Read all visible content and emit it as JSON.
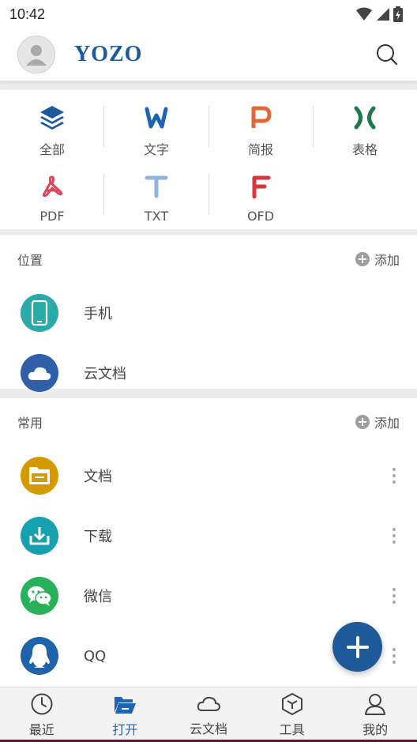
{
  "status": {
    "time": "10:42"
  },
  "header": {
    "logo": "YOZO"
  },
  "types": [
    {
      "label": "全部",
      "icon": "layers-icon",
      "color": "#1e5a99"
    },
    {
      "label": "文字",
      "icon": "word-icon",
      "color": "#1e64b4"
    },
    {
      "label": "简报",
      "icon": "presentation-icon",
      "color": "#e2673a"
    },
    {
      "label": "表格",
      "icon": "spreadsheet-icon",
      "color": "#1d7a4a"
    },
    {
      "label": "PDF",
      "icon": "pdf-icon",
      "color": "#e0445a"
    },
    {
      "label": "TXT",
      "icon": "txt-icon",
      "color": "#8db4e2"
    },
    {
      "label": "OFD",
      "icon": "ofd-icon",
      "color": "#d9363e"
    }
  ],
  "location": {
    "title": "位置",
    "add_label": "添加",
    "items": [
      {
        "name": "手机",
        "icon": "phone-icon",
        "color": "#2aaaa8"
      },
      {
        "name": "云文档",
        "icon": "cloud-icon",
        "color": "#2f5fa6"
      }
    ]
  },
  "frequent": {
    "title": "常用",
    "add_label": "添加",
    "items": [
      {
        "name": "文档",
        "icon": "folder-icon",
        "color": "#d49a00"
      },
      {
        "name": "下载",
        "icon": "download-icon",
        "color": "#16a0b0"
      },
      {
        "name": "微信",
        "icon": "wechat-icon",
        "color": "#27b15a"
      },
      {
        "name": "QQ",
        "icon": "qq-icon",
        "color": "#1f63aa"
      }
    ]
  },
  "nav": [
    {
      "label": "最近",
      "icon": "clock-icon"
    },
    {
      "label": "打开",
      "icon": "folder-open-icon",
      "active": true
    },
    {
      "label": "云文档",
      "icon": "cloud-outline-icon"
    },
    {
      "label": "工具",
      "icon": "toolbox-icon"
    },
    {
      "label": "我的",
      "icon": "user-icon"
    }
  ],
  "colors": {
    "accent": "#1e5a99",
    "active_tab": "#1e64b4"
  }
}
